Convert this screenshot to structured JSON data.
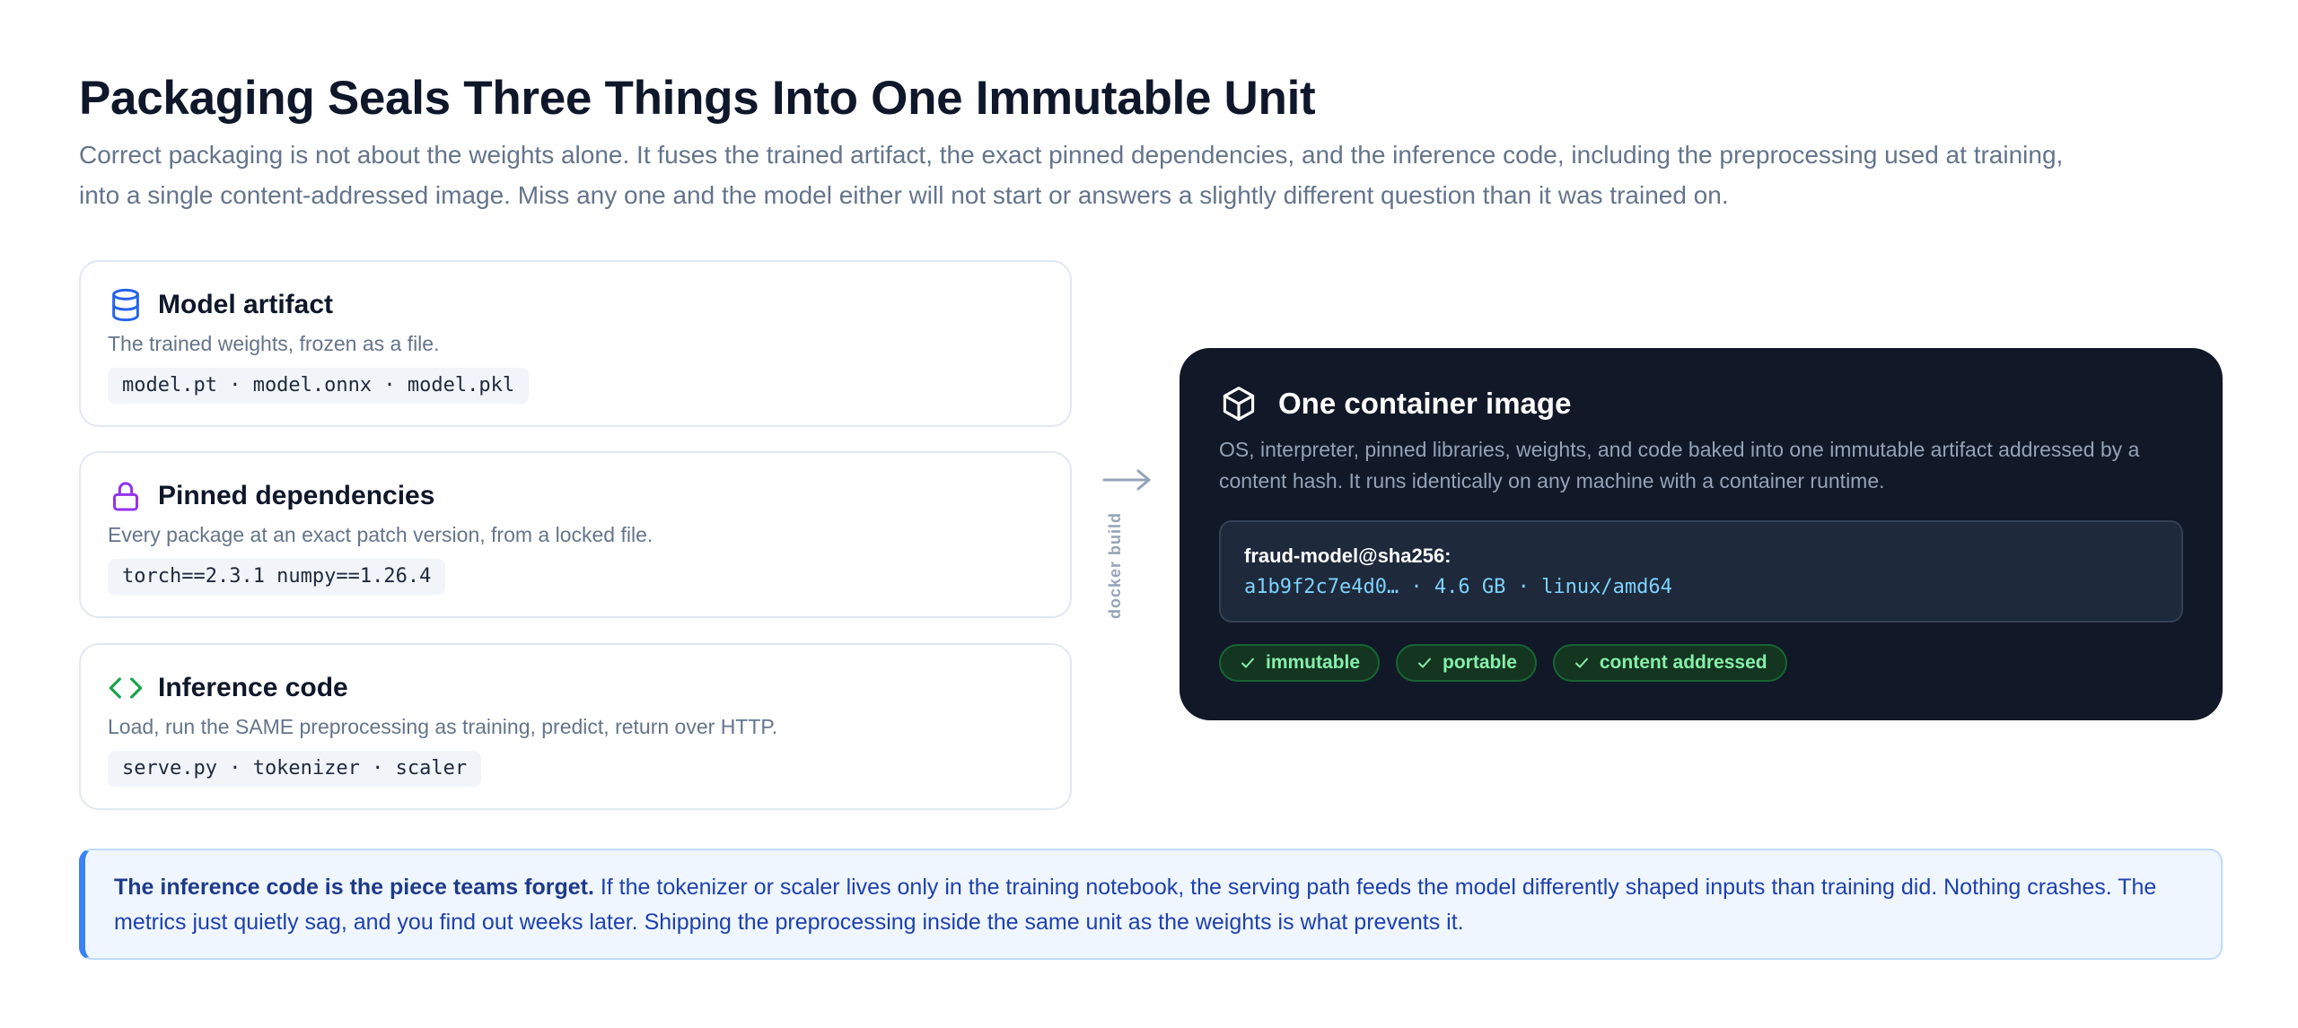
{
  "header": {
    "title": "Packaging Seals Three Things Into One Immutable Unit",
    "intro": "Correct packaging is not about the weights alone. It fuses the trained artifact, the exact pinned dependencies, and the inference code, including the preprocessing used at training, into a single content-addressed image. Miss any one and the model either will not start or answers a slightly different question than it was trained on."
  },
  "inputs": [
    {
      "title": "Model artifact",
      "icon": "database-icon",
      "color": "#2563eb",
      "description": "The trained weights, frozen as a file.",
      "code": "model.pt · model.onnx · model.pkl"
    },
    {
      "title": "Pinned dependencies",
      "icon": "lock-icon",
      "color": "#9333ea",
      "description": "Every package at an exact patch version, from a locked file.",
      "code": "torch==2.3.1 numpy==1.26.4"
    },
    {
      "title": "Inference code",
      "icon": "code-icon",
      "color": "#16a34a",
      "description": "Load, run the SAME preprocessing as training, predict, return over HTTP.",
      "code": "serve.py · tokenizer · scaler"
    }
  ],
  "arrow": {
    "label": "docker build"
  },
  "output": {
    "title": "One container image",
    "icon": "package-icon",
    "description": "OS, interpreter, pinned libraries, weights, and code baked into one immutable artifact addressed by a content hash. It runs identically on any machine with a container runtime.",
    "image_name": "fraud-model@sha256:",
    "image_details": "a1b9f2c7e4d0… · 4.6 GB · linux/amd64",
    "tags": [
      "immutable",
      "portable",
      "content addressed"
    ]
  },
  "callout": {
    "lead": "The inference code is the piece teams forget.",
    "body": " If the tokenizer or scaler lives only in the training notebook, the serving path feeds the model differently shaped inputs than training did. Nothing crashes. The metrics just quietly sag, and you find out weeks later. Shipping the preprocessing inside the same unit as the weights is what prevents it."
  }
}
